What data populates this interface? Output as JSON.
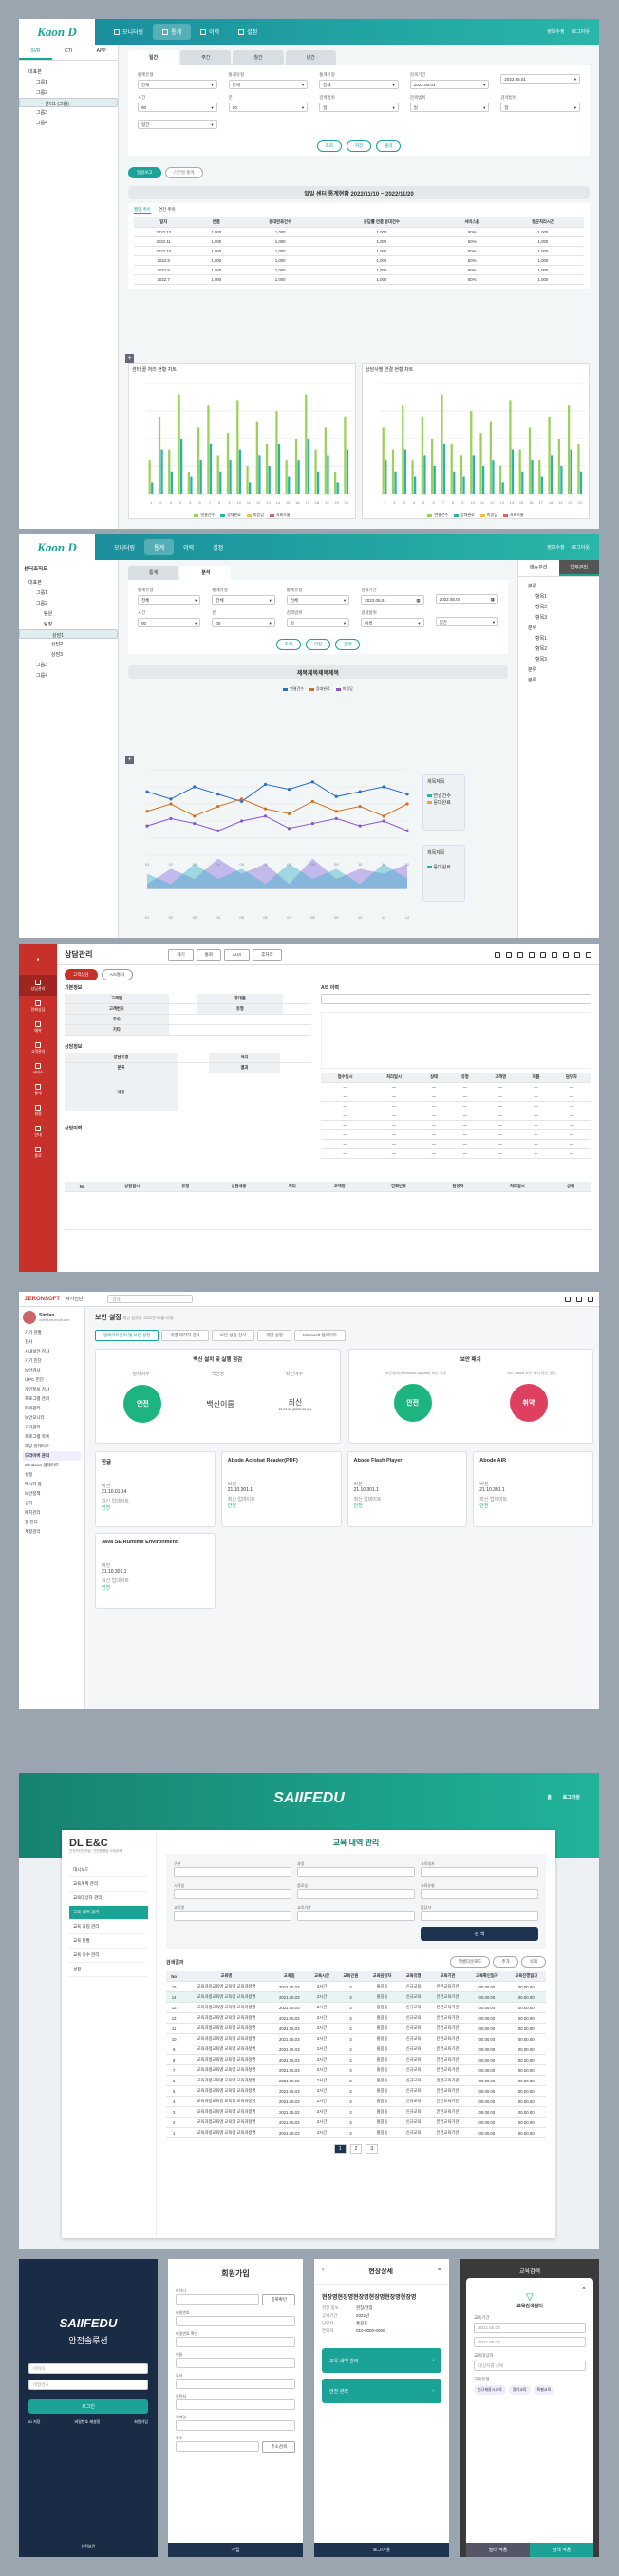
{
  "p1": {
    "logo": "Kaon D",
    "nav": [
      "모니터링",
      "통계",
      "이력",
      "설정"
    ],
    "right": [
      "정보수정",
      "로그아웃"
    ],
    "side_tabs": [
      "SVR",
      "CTI",
      "APP"
    ],
    "tree": [
      "대표본",
      "그룹1",
      "그룹2",
      "센터1 (그룹)",
      "그룹3",
      "그룹4"
    ],
    "tabs": [
      "일간",
      "주간",
      "월간",
      "년간"
    ],
    "filters": [
      [
        "통계유형",
        "전체"
      ],
      [
        "통계유형",
        "전체"
      ],
      [
        "통계유형",
        "전체"
      ],
      [
        "검색기간",
        "2022.05.01"
      ],
      [
        "",
        "2022.05.01"
      ],
      [
        "시간",
        "00"
      ],
      [
        "분",
        "00"
      ],
      [
        "검색범위",
        "일"
      ],
      [
        "검색범위",
        "일"
      ],
      [
        "검색범위",
        "일"
      ],
      [
        "",
        "일간"
      ]
    ],
    "btns": [
      "조회",
      "저장",
      "출력"
    ],
    "toggle": [
      "일일보고",
      "기간별 통계"
    ],
    "report_title": "일일 센터 통계현황 2022/11/10 ~ 2022/11/20",
    "sub_tabs": [
      "월별 추이",
      "연간 추이"
    ],
    "table_head": [
      "일자",
      "연결",
      "응대완료건수",
      "응답률 연결 응대건수",
      "서비스율",
      "평균처리시간"
    ],
    "table_rows": [
      [
        "2022.12",
        "1,000",
        "1,000",
        "1,000",
        "50%",
        "1,000"
      ],
      [
        "2022.11",
        "1,000",
        "1,000",
        "1,000",
        "50%",
        "1,000"
      ],
      [
        "2022.10",
        "1,000",
        "1,000",
        "1,000",
        "50%",
        "1,000"
      ],
      [
        "2022.9",
        "1,000",
        "1,000",
        "1,000",
        "50%",
        "1,000"
      ],
      [
        "2022.8",
        "1,000",
        "1,000",
        "1,000",
        "50%",
        "1,000"
      ],
      [
        "2022.7",
        "1,000",
        "1,000",
        "1,000",
        "50%",
        "1,000"
      ]
    ],
    "chart_titles": [
      "센터 콜 처리 현황 차트",
      "상담사별 연결 현황 차트"
    ],
    "legend1": [
      "연결건수",
      "응대완료",
      "미응답",
      "서비스율"
    ],
    "legend2": [
      "연결건수",
      "응대완료",
      "미응답",
      "서비스율"
    ]
  },
  "chart_data": [
    {
      "type": "bar",
      "title": "센터 콜 처리 현황 차트",
      "categories": [
        "1",
        "2",
        "3",
        "4",
        "5",
        "6",
        "7",
        "8",
        "9",
        "10",
        "11",
        "12",
        "13",
        "14",
        "15",
        "16",
        "17",
        "18",
        "19",
        "20",
        "21"
      ],
      "series": [
        {
          "name": "연결건수",
          "values": [
            30,
            70,
            40,
            90,
            20,
            60,
            80,
            35,
            55,
            85,
            25,
            65,
            45,
            75,
            30,
            50,
            90,
            40,
            60,
            20,
            70
          ]
        },
        {
          "name": "응대완료",
          "values": [
            10,
            40,
            20,
            50,
            15,
            30,
            45,
            20,
            30,
            40,
            10,
            35,
            25,
            45,
            15,
            30,
            50,
            20,
            35,
            10,
            40
          ]
        }
      ],
      "ylim": [
        0,
        100
      ]
    },
    {
      "type": "bar",
      "title": "상담사별 연결 현황 차트",
      "categories": [
        "1",
        "2",
        "3",
        "4",
        "5",
        "6",
        "7",
        "8",
        "9",
        "10",
        "11",
        "12",
        "13",
        "14",
        "15",
        "16",
        "17",
        "18",
        "19",
        "20",
        "21"
      ],
      "series": [
        {
          "name": "연결건수",
          "values": [
            60,
            40,
            80,
            30,
            70,
            50,
            90,
            45,
            35,
            75,
            55,
            65,
            25,
            85,
            40,
            60,
            30,
            70,
            50,
            80,
            45
          ]
        },
        {
          "name": "응대완료",
          "values": [
            30,
            20,
            40,
            15,
            35,
            25,
            45,
            20,
            15,
            35,
            25,
            30,
            10,
            40,
            20,
            30,
            15,
            35,
            25,
            40,
            20
          ]
        }
      ],
      "ylim": [
        0,
        100
      ]
    },
    {
      "type": "line",
      "title": "",
      "categories": [
        "01",
        "02",
        "03",
        "04",
        "05",
        "06",
        "07",
        "08",
        "09",
        "10",
        "11",
        "12"
      ],
      "series": [
        {
          "name": "연결건수",
          "values": [
            2600,
            2300,
            2800,
            2500,
            2200,
            2900,
            2700,
            3000,
            2400,
            2600,
            2800,
            2500
          ]
        },
        {
          "name": "응대완료",
          "values": [
            1800,
            2100,
            1600,
            2000,
            2300,
            1900,
            1700,
            2200,
            1800,
            2000,
            1600,
            2100
          ]
        },
        {
          "name": "미응답",
          "values": [
            1200,
            1500,
            1300,
            1000,
            1400,
            1600,
            1100,
            1300,
            1500,
            1200,
            1400,
            1000
          ]
        }
      ],
      "ylim": [
        0,
        3500
      ]
    },
    {
      "type": "area",
      "title": "",
      "categories": [
        "01",
        "02",
        "03",
        "04",
        "05",
        "06",
        "07",
        "08",
        "09",
        "10",
        "11",
        "12"
      ],
      "series": [
        {
          "name": "A",
          "values": [
            5,
            20,
            10,
            30,
            15,
            25,
            5,
            30,
            10,
            20,
            15,
            25
          ]
        },
        {
          "name": "B",
          "values": [
            15,
            5,
            25,
            10,
            20,
            5,
            25,
            10,
            20,
            5,
            25,
            10
          ]
        }
      ],
      "ylim": [
        -20,
        40
      ]
    }
  ],
  "p2": {
    "logo": "Kaon D",
    "nav": [
      "모니터링",
      "통계",
      "이력",
      "설정"
    ],
    "right": [
      "정보수정",
      "로그아웃"
    ],
    "tree_title": "센터조직도",
    "tree": [
      "대표본",
      "그룹1",
      "그룹2",
      "팀원",
      "팀장",
      "상담1",
      "상담2",
      "상담3",
      "그룹3",
      "그룹4"
    ],
    "tabs": [
      "통계",
      "분석"
    ],
    "right_tabs": [
      "메뉴관리",
      "업무관리"
    ],
    "right_tree": [
      "분류",
      "항목1",
      "항목2",
      "항목3",
      "분류",
      "항목1",
      "항목2",
      "항목3",
      "분류",
      "분류"
    ],
    "section_title": "제목제목제목제목",
    "legend": [
      "연결건수",
      "응대완료",
      "미응답"
    ],
    "side_legend1": [
      "제목제목",
      "연결건수",
      "응대완료"
    ],
    "side_legend2": [
      "제목제목",
      "응대완료"
    ]
  },
  "p3": {
    "title": "상담관리",
    "tabs": [
      "고객상담",
      "A/S통화"
    ],
    "sidebar": [
      "상담관리",
      "전화상담",
      "예약",
      "고객관리",
      "서비스",
      "통계",
      "설정",
      "안내",
      "종료"
    ],
    "toolbar": [
      "대기",
      "통화",
      "AUX",
      "후처리"
    ],
    "sec1": "기본정보",
    "sec2": "A/S 이력",
    "sec3": "상담정보",
    "sec4": "상담이력",
    "right_head": [
      "접수일시",
      "처리일시",
      "상태",
      "유형",
      "고객명",
      "제품",
      "담당자"
    ],
    "right_rows": 8,
    "bottom_head": [
      "No",
      "상담일시",
      "유형",
      "상담내용",
      "처리",
      "고객명",
      "전화번호",
      "담당자",
      "처리일시",
      "상태"
    ]
  },
  "p4": {
    "brand": "ZERONSOFT",
    "brand_sub": "자가진단",
    "search": "검색",
    "user": "Simlan",
    "user_mail": "user@zeronsoft.com",
    "menu": [
      "기기 현황",
      "검사",
      "사내보안 검사",
      "기기 진단",
      "보안검사",
      "내PC 진단",
      "개인정보 검사",
      "프로그램 관리",
      "파워관리",
      "보안모니터",
      "기기관리",
      "프로그램 목록",
      "해당 업데이트",
      "드라이버 관리",
      "Windows 업데이트",
      "설정",
      "메시지 함",
      "보안정책",
      "공지",
      "패치관리",
      "웹 관리",
      "계정관리"
    ],
    "title": "보안 설정",
    "title_sub": "최근 검사일: 2022년 02월 02일",
    "tabs": [
      "업데이트관리 및 보안 설정",
      "개별 패키지 검사",
      "보안 설정 검사",
      "개별 설정",
      "Microsoft 업데이트"
    ],
    "card1_title": "백신 설치 및 실행 점검",
    "card1_cols": [
      "설치여부",
      "백신명",
      "최신여부"
    ],
    "card1_vals": [
      "안전",
      "백신이름",
      "최신"
    ],
    "card1_date": "21.07.28 (2022.03.12)",
    "card2_title": "보안 패치",
    "card2_cols": [
      "보안패치(Windows Update) 최신 유무",
      "MS Office 보안 패치 최신 설치"
    ],
    "card2_vals": [
      "안전",
      "취약"
    ],
    "apps": [
      [
        "한글",
        "21.10.01.14"
      ],
      [
        "Abode Acrobat Reader(PDF)",
        "21.10.301.1"
      ],
      [
        "Abode Flash Player",
        "21.10.301.1"
      ],
      [
        "Abode AIR",
        "21.10.301.1"
      ],
      [
        "Java SE Runtime Environment",
        "21.10.301.1"
      ]
    ],
    "app_labels": [
      "버전",
      "최신 업데이트",
      "안전"
    ]
  },
  "p5": {
    "brand": "SAIIFEDU",
    "top_right": [
      "홈",
      "로그아웃"
    ],
    "company": "DL E&C",
    "company_sub": "안전보건관리팀 / 안전환경팀 사내교육",
    "menu": [
      "대시보드",
      "교육계획 관리",
      "교육대상자 관리",
      "교육 내역 관리",
      "교육 과정 관리",
      "교육 현황",
      "교육 이수 관리",
      "설정"
    ],
    "page_title": "교육 내역 관리",
    "filters": [
      "구분",
      "과정",
      "교육일자",
      "시작일",
      "종료일",
      "교육유형",
      "교육명",
      "교육기관",
      "담당자"
    ],
    "search_btn": "검 색",
    "list_title": "검색결과",
    "list_btns": [
      "엑셀다운로드",
      "추가",
      "삭제"
    ],
    "head": [
      "No",
      "교육명",
      "교육일",
      "교육시간",
      "교육인원",
      "교육담당자",
      "교육유형",
      "교육기관",
      "교육확인일자",
      "교육진행일자"
    ],
    "rows": 15,
    "row_text": [
      "교육과정교육명 교육명 교육과정명",
      "2021.05.03",
      "2시간",
      "3",
      "홍길동",
      "신규교육",
      "안전교육기관",
      "00.00.00",
      "00.00.00"
    ],
    "pager": [
      "1",
      "2",
      "3"
    ]
  },
  "p6": {
    "brand": "SAIIFEDU",
    "sub": "안전솔루션",
    "id_ph": "아이디",
    "pw_ph": "비밀번호",
    "login": "로그인",
    "links": [
      "ID 저장",
      "비밀번호 재설정",
      "회원가입"
    ],
    "footer": "안전보건"
  },
  "p7": {
    "title": "회원가입",
    "fields": [
      "아이디",
      "비밀번호",
      "비밀번호 확인",
      "이름",
      "부서",
      "연락처",
      "이메일",
      "주소"
    ],
    "dup_btn": "중복확인",
    "addr_btn": "주소검색",
    "submit": "가입"
  },
  "p8": {
    "title": "현장상세",
    "info_title": "현장명현장명현장명현장명현장명현장명",
    "info_rows": [
      [
        "현장 정보",
        "현장/현장"
      ],
      [
        "공사기간",
        "2022년"
      ],
      [
        "담당자",
        "홍길동"
      ],
      [
        "연락처",
        "010-0000-0000"
      ]
    ],
    "btn1": "교육 내역 관리",
    "btn2": "안전 관리",
    "footer": "로그아웃"
  },
  "p9": {
    "title": "교육검색",
    "modal_title": "교육검색필터",
    "labels": [
      "교육기간",
      "교육명",
      "교육대상자",
      "교육유형"
    ],
    "vals": [
      "2021.05.03",
      "2021.05.03",
      "대상자를 선택"
    ],
    "chips": [
      "신규채용시교육",
      "정기교육",
      "특별교육"
    ],
    "btn_reset": "필터 적용",
    "btn_apply": "검색 적용"
  }
}
